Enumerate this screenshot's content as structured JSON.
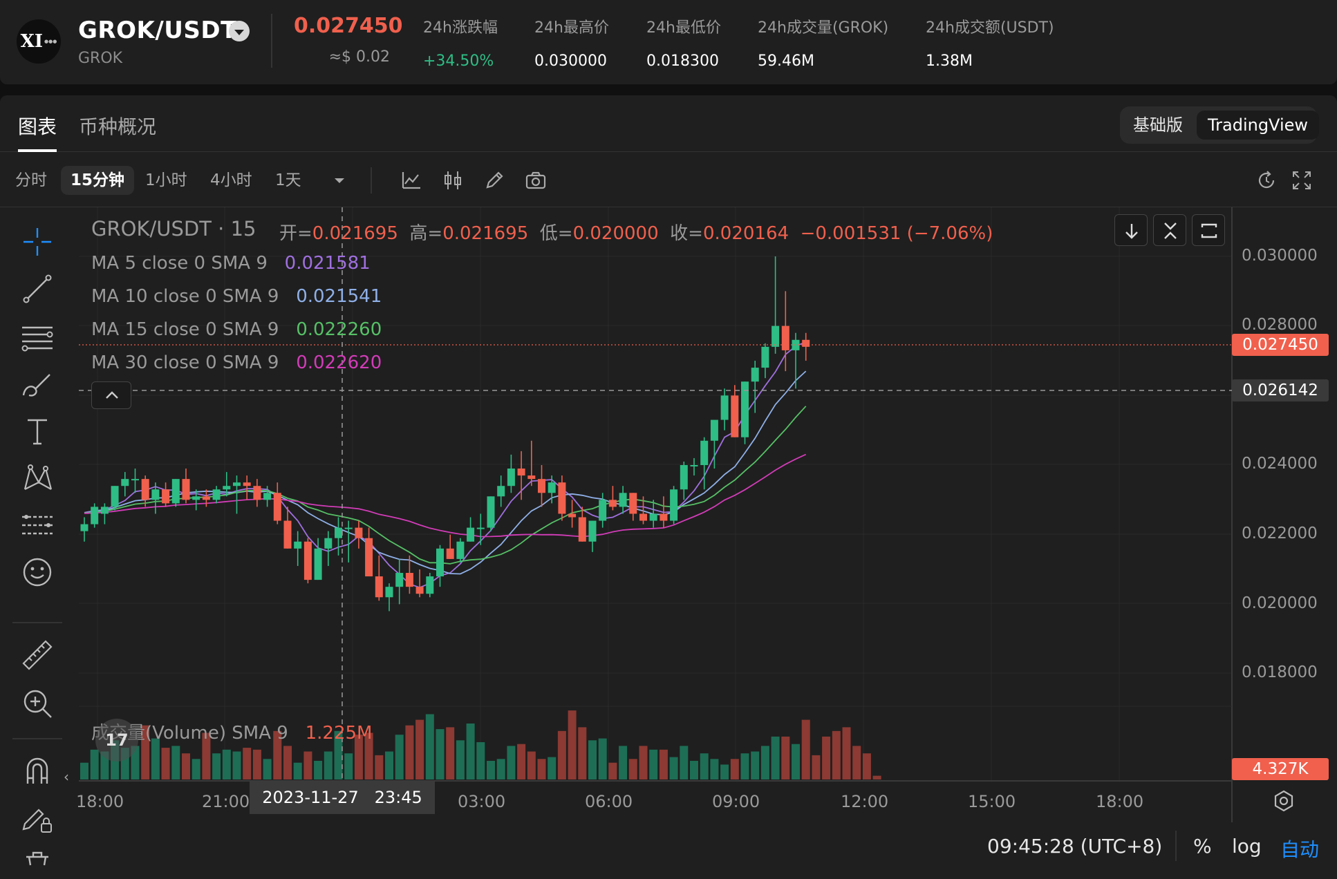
{
  "ticker": {
    "logo_text": "XI",
    "pair": "GROK/USDT",
    "base": "GROK",
    "last_price": "0.027450",
    "last_usd": "≈$ 0.02",
    "stats": [
      {
        "label": "24h涨跌幅",
        "value": "+34.50%",
        "color": "#2ebd85"
      },
      {
        "label": "24h最高价",
        "value": "0.030000"
      },
      {
        "label": "24h最低价",
        "value": "0.018300"
      },
      {
        "label": "24h成交量(GROK)",
        "value": "59.46M"
      },
      {
        "label": "24h成交额(USDT)",
        "value": "1.38M"
      }
    ]
  },
  "tabs": [
    {
      "label": "图表",
      "active": true
    },
    {
      "label": "币种概况",
      "active": false
    }
  ],
  "view_switch": [
    {
      "label": "基础版",
      "active": false
    },
    {
      "label": "TradingView",
      "active": true
    }
  ],
  "intervals": [
    {
      "label": "分时",
      "active": false
    },
    {
      "label": "15分钟",
      "active": true
    },
    {
      "label": "1小时",
      "active": false
    },
    {
      "label": "4小时",
      "active": false
    },
    {
      "label": "1天",
      "active": false
    }
  ],
  "toolbar_icons": [
    "chevron-down-icon",
    "indicator-icon",
    "chart-type-icon",
    "pencil-icon",
    "camera-icon",
    "history-icon",
    "fullscreen-icon"
  ],
  "left_tools": [
    "crosshair-icon",
    "trendline-icon",
    "fib-lines-icon",
    "brush-icon",
    "text-icon",
    "pattern-icon",
    "prediction-icon",
    "emoji-icon",
    "ruler-icon",
    "zoom-in-icon",
    "magnet-icon",
    "lock-drawing-icon",
    "trash-icon"
  ],
  "legend": {
    "symbol": "GROK/USDT · 15",
    "ohlc": [
      {
        "k": "开=",
        "v": "0.021695"
      },
      {
        "k": "高=",
        "v": "0.021695"
      },
      {
        "k": "低=",
        "v": "0.020000"
      },
      {
        "k": "收=",
        "v": "0.020164"
      }
    ],
    "change": "−0.001531 (−7.06%)",
    "ma": [
      {
        "label": "MA 5 close 0 SMA 9",
        "value": "0.021581",
        "color": "#a070e0"
      },
      {
        "label": "MA 10 close 0 SMA 9",
        "value": "0.021541",
        "color": "#8fb0e8"
      },
      {
        "label": "MA 15 close 0 SMA 9",
        "value": "0.022260",
        "color": "#56c066"
      },
      {
        "label": "MA 30 close 0 SMA 9",
        "value": "0.022620",
        "color": "#d23cb8"
      }
    ],
    "volume_label": "成交量(Volume) SMA 9",
    "volume_value": "1.225M"
  },
  "price_tags": {
    "last": "0.027450",
    "crosshair": "0.026142",
    "volume": "4.327K"
  },
  "crosshair_time": "2023-11-27   23:45",
  "bottom": {
    "clock": "09:45:28 (UTC+8)",
    "percent": "%",
    "log": "log",
    "auto": "自动"
  },
  "colors": {
    "up": "#2ebd85",
    "down": "#f0604d",
    "bg": "#1f1f1f",
    "accent": "#1e8fff"
  },
  "chart_data": {
    "type": "candlestick",
    "interval": "15m",
    "y_ticks": [
      "0.030000",
      "0.028000",
      "0.024000",
      "0.022000",
      "0.020000",
      "0.018000"
    ],
    "x_ticks": [
      "18:00",
      "21:00",
      "03:00",
      "06:00",
      "09:00",
      "12:00",
      "15:00",
      "18:00"
    ],
    "candles": [
      [
        0.0221,
        0.0225,
        0.0218,
        0.0223
      ],
      [
        0.0223,
        0.0229,
        0.0222,
        0.0228
      ],
      [
        0.0226,
        0.0229,
        0.0223,
        0.0228
      ],
      [
        0.0228,
        0.0234,
        0.0227,
        0.0234
      ],
      [
        0.0234,
        0.0238,
        0.0231,
        0.0236
      ],
      [
        0.0236,
        0.0239,
        0.0232,
        0.0236
      ],
      [
        0.0236,
        0.0237,
        0.0228,
        0.023
      ],
      [
        0.023,
        0.0235,
        0.0226,
        0.0233
      ],
      [
        0.0233,
        0.0235,
        0.0228,
        0.0229
      ],
      [
        0.0229,
        0.0236,
        0.0228,
        0.0236
      ],
      [
        0.0236,
        0.0239,
        0.0229,
        0.023
      ],
      [
        0.023,
        0.0233,
        0.0227,
        0.0231
      ],
      [
        0.0231,
        0.0233,
        0.0228,
        0.023
      ],
      [
        0.023,
        0.0234,
        0.0229,
        0.0233
      ],
      [
        0.0233,
        0.0238,
        0.0231,
        0.0234
      ],
      [
        0.0234,
        0.0237,
        0.0226,
        0.0235
      ],
      [
        0.0235,
        0.0237,
        0.023,
        0.0234
      ],
      [
        0.0234,
        0.0236,
        0.0228,
        0.023
      ],
      [
        0.023,
        0.0234,
        0.0228,
        0.0232
      ],
      [
        0.0232,
        0.0235,
        0.0223,
        0.0224
      ],
      [
        0.0224,
        0.0228,
        0.0216,
        0.0216
      ],
      [
        0.0216,
        0.0221,
        0.0211,
        0.0218
      ],
      [
        0.0218,
        0.0219,
        0.0206,
        0.0207
      ],
      [
        0.0207,
        0.0219,
        0.0207,
        0.0216
      ],
      [
        0.0216,
        0.0221,
        0.0211,
        0.0219
      ],
      [
        0.0219,
        0.0225,
        0.0214,
        0.0222
      ],
      [
        0.0222,
        0.0224,
        0.0212,
        0.0222
      ],
      [
        0.0222,
        0.0224,
        0.0216,
        0.0219
      ],
      [
        0.0219,
        0.0222,
        0.021,
        0.0208
      ],
      [
        0.0208,
        0.0214,
        0.0201,
        0.0202
      ],
      [
        0.0202,
        0.0206,
        0.0198,
        0.0205
      ],
      [
        0.0205,
        0.0213,
        0.02,
        0.0209
      ],
      [
        0.0209,
        0.0214,
        0.0203,
        0.0205
      ],
      [
        0.0205,
        0.021,
        0.0202,
        0.0203
      ],
      [
        0.0203,
        0.0209,
        0.0202,
        0.0208
      ],
      [
        0.0208,
        0.0217,
        0.0205,
        0.0216
      ],
      [
        0.0216,
        0.022,
        0.0213,
        0.0213
      ],
      [
        0.0213,
        0.0219,
        0.0212,
        0.0218
      ],
      [
        0.0218,
        0.0225,
        0.0218,
        0.0222
      ],
      [
        0.0222,
        0.0226,
        0.0217,
        0.0222
      ],
      [
        0.0222,
        0.0231,
        0.0221,
        0.0231
      ],
      [
        0.0231,
        0.0237,
        0.0228,
        0.0234
      ],
      [
        0.0234,
        0.0243,
        0.0232,
        0.0239
      ],
      [
        0.0239,
        0.0244,
        0.023,
        0.0237
      ],
      [
        0.0237,
        0.0247,
        0.0234,
        0.0236
      ],
      [
        0.0236,
        0.024,
        0.0228,
        0.0232
      ],
      [
        0.0232,
        0.0237,
        0.0229,
        0.0235
      ],
      [
        0.0235,
        0.0237,
        0.0224,
        0.0226
      ],
      [
        0.0226,
        0.023,
        0.0222,
        0.0225
      ],
      [
        0.0225,
        0.0228,
        0.0218,
        0.0218
      ],
      [
        0.0218,
        0.0224,
        0.0215,
        0.0224
      ],
      [
        0.0224,
        0.0232,
        0.0222,
        0.023
      ],
      [
        0.023,
        0.0234,
        0.0227,
        0.0228
      ],
      [
        0.0228,
        0.0234,
        0.0226,
        0.0232
      ],
      [
        0.0232,
        0.0232,
        0.0224,
        0.0226
      ],
      [
        0.0226,
        0.0231,
        0.0223,
        0.0224
      ],
      [
        0.0224,
        0.023,
        0.0222,
        0.0226
      ],
      [
        0.0226,
        0.0231,
        0.0222,
        0.0224
      ],
      [
        0.0224,
        0.0234,
        0.0223,
        0.0233
      ],
      [
        0.0233,
        0.0241,
        0.023,
        0.024
      ],
      [
        0.024,
        0.0242,
        0.0237,
        0.024
      ],
      [
        0.024,
        0.0248,
        0.0233,
        0.0247
      ],
      [
        0.0247,
        0.0252,
        0.0239,
        0.0253
      ],
      [
        0.0253,
        0.0262,
        0.025,
        0.026
      ],
      [
        0.026,
        0.0263,
        0.0248,
        0.0248
      ],
      [
        0.0248,
        0.0264,
        0.0246,
        0.0264
      ],
      [
        0.0264,
        0.027,
        0.0255,
        0.0268
      ],
      [
        0.0268,
        0.0275,
        0.0265,
        0.0274
      ],
      [
        0.0274,
        0.03,
        0.0272,
        0.028
      ],
      [
        0.028,
        0.029,
        0.0267,
        0.0273
      ],
      [
        0.0273,
        0.0278,
        0.0262,
        0.0276
      ],
      [
        0.0276,
        0.0278,
        0.027,
        0.0274
      ]
    ],
    "volumes": [
      0.9,
      1.6,
      1.5,
      2.1,
      1.7,
      1.8,
      2.9,
      2.2,
      1.7,
      1.8,
      1.4,
      1.1,
      2.5,
      1.4,
      1.6,
      1.5,
      1.7,
      1.6,
      1.1,
      2.6,
      1.8,
      0.9,
      1.5,
      1.0,
      1.5,
      2.6,
      1.4,
      2.4,
      2.5,
      1.3,
      1.5,
      2.4,
      2.9,
      3.2,
      3.5,
      2.7,
      2.8,
      2.1,
      3.0,
      2.0,
      1.0,
      1.1,
      1.8,
      1.9,
      1.5,
      1.1,
      1.2,
      2.6,
      3.7,
      2.8,
      2.1,
      2.2,
      0.9,
      1.8,
      1.1,
      1.8,
      1.6,
      1.6,
      1.2,
      1.8,
      1.0,
      1.4,
      1.1,
      0.8,
      1.1,
      1.4,
      1.5,
      1.8,
      2.3,
      2.3,
      1.9,
      3.2,
      1.3,
      2.3,
      2.6,
      2.8,
      1.8,
      1.4,
      0.2
    ]
  }
}
